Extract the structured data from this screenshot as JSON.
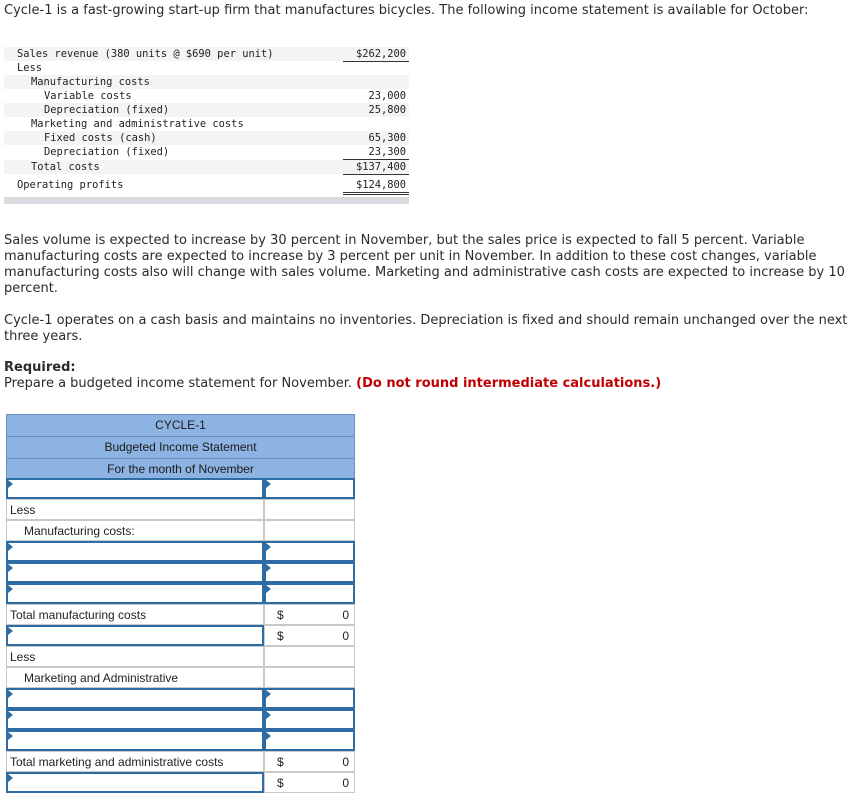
{
  "intro": "Cycle-1 is a fast-growing start-up firm that manufactures bicycles. The following income statement is available for October:",
  "october": {
    "sales_label": "Sales revenue (380 units @ $690 per unit)",
    "sales_amount": "$262,200",
    "less": "Less",
    "mfg_costs": "Manufacturing costs",
    "variable_costs": "Variable costs",
    "variable_amount": "23,000",
    "depreciation_fixed": "Depreciation (fixed)",
    "mfg_depr_amount": "25,800",
    "mkt_admin": "Marketing and administrative costs",
    "fixed_cash": "Fixed costs (cash)",
    "fixed_cash_amount": "65,300",
    "mkt_depr_amount": "23,300",
    "total_costs": "Total costs",
    "total_costs_amount": "$137,400",
    "operating_profits": "Operating profits",
    "operating_profits_amount": "$124,800"
  },
  "para1": "Sales volume is expected to increase by 30 percent in November, but the sales price is expected to fall 5 percent. Variable manufacturing costs are expected to increase by 3 percent per unit in November. In addition to these cost changes, variable manufacturing costs also will change with sales volume. Marketing and administrative cash costs are expected to increase by 10 percent.",
  "para2": "Cycle-1 operates on a cash basis and maintains no inventories. Depreciation is fixed and should remain unchanged over the next three years.",
  "required": {
    "heading": "Required:",
    "text": "Prepare a budgeted income statement for November.",
    "note": "(Do not round intermediate calculations.)"
  },
  "budget": {
    "company": "CYCLE-1",
    "title": "Budgeted Income Statement",
    "period": "For the month of November",
    "less": "Less",
    "manufacturing_costs": "Manufacturing costs:",
    "total_manufacturing": "Total manufacturing costs",
    "marketing_admin": "Marketing and Administrative",
    "total_marketing": "Total marketing and administrative costs",
    "currency": "$",
    "zero": "0"
  }
}
